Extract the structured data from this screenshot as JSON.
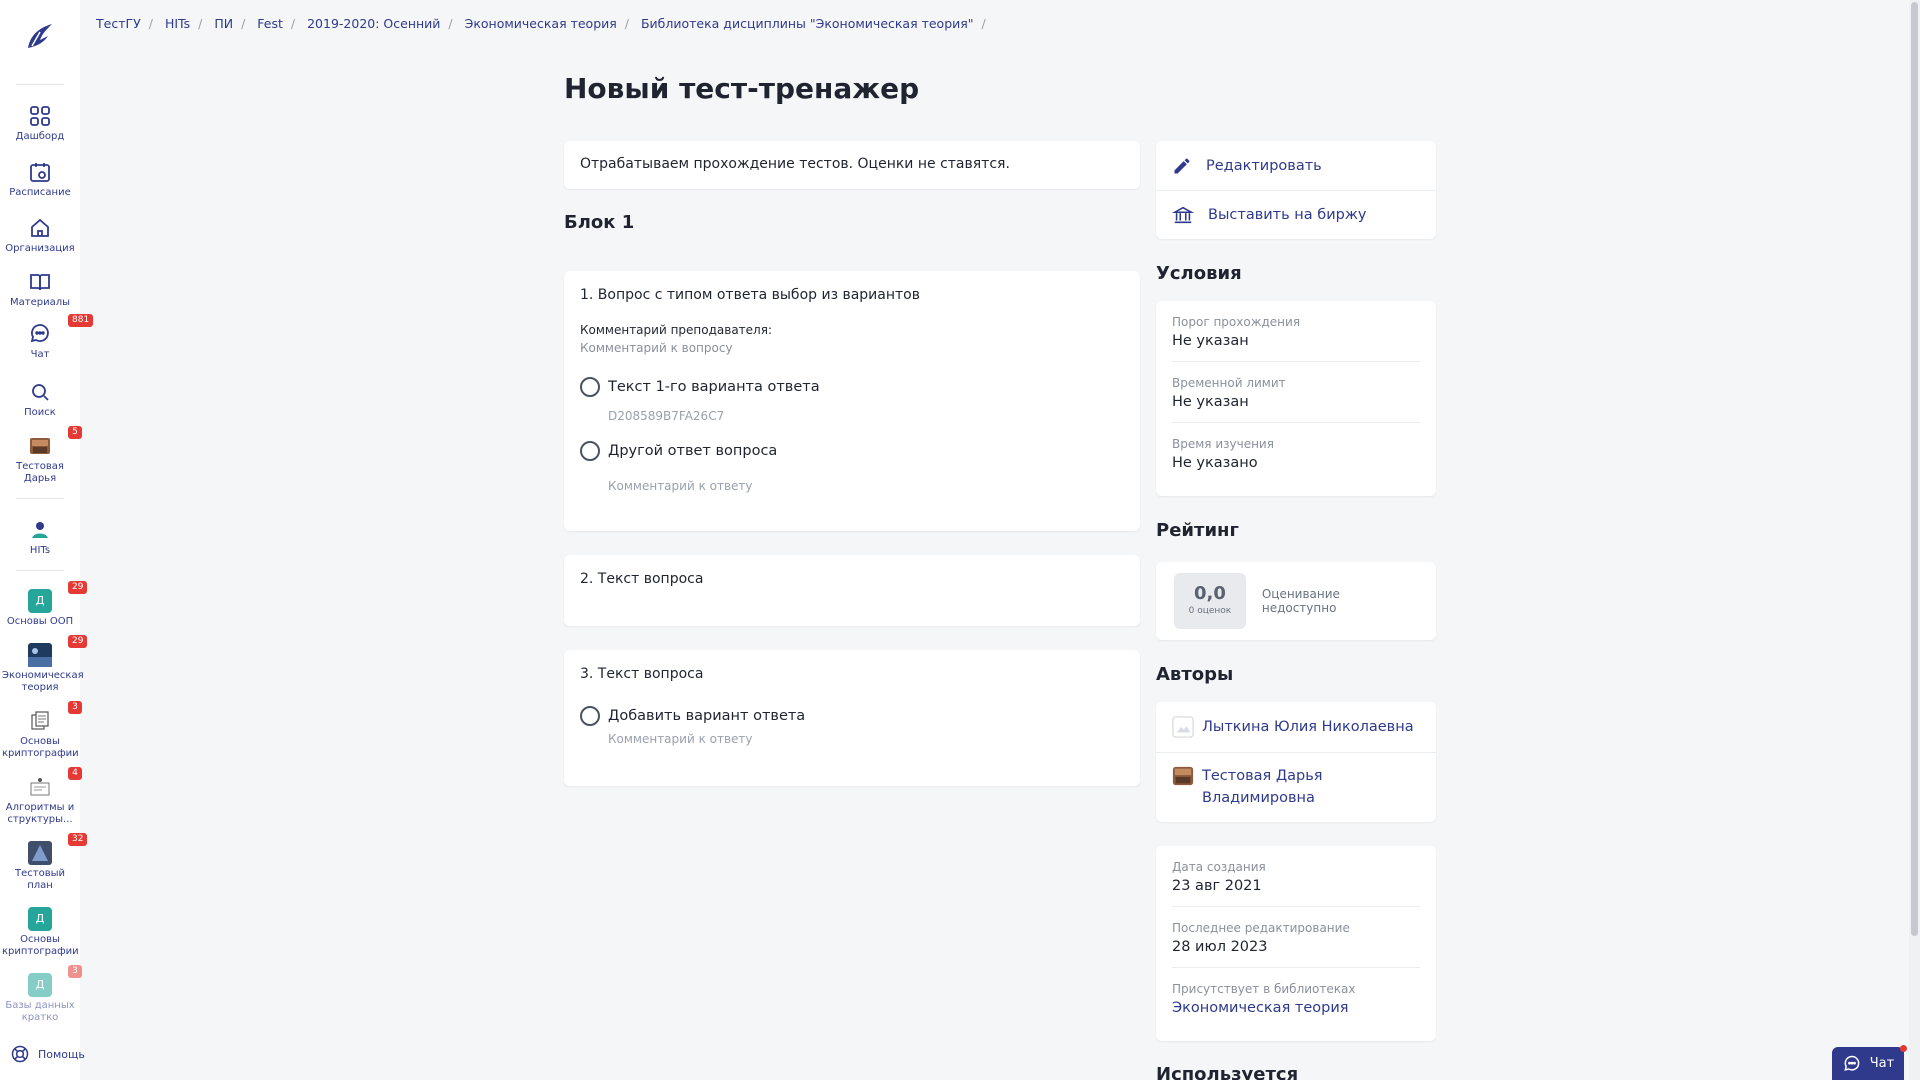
{
  "colors": {
    "accent": "#2f3a8c",
    "badge": "#e53935",
    "teal": "#26a69a"
  },
  "breadcrumbs": [
    "ТестГУ",
    "HITs",
    "ПИ",
    "Fest",
    "2019-2020: Осенний",
    "Экономическая теория",
    "Библиотека дисциплины \"Экономическая теория\""
  ],
  "sidebar": {
    "items": [
      {
        "label": "Дашборд",
        "icon": "grid-icon"
      },
      {
        "label": "Расписание",
        "icon": "calendar-icon"
      },
      {
        "label": "Организация",
        "icon": "home-icon"
      },
      {
        "label": "Материалы",
        "icon": "book-icon"
      },
      {
        "label": "Чат",
        "icon": "chat-icon",
        "badge": "881"
      },
      {
        "label": "Поиск",
        "icon": "search-icon"
      },
      {
        "label": "Тестовая Дарья",
        "icon": "avatar-icon",
        "badge": "5"
      },
      {
        "label": "HITs",
        "icon": "hits-logo-icon"
      },
      {
        "label": "Основы ООП",
        "icon": "course-icon",
        "badge": "29",
        "letter": "Д"
      },
      {
        "label": "Экономическая теория",
        "icon": "course-image-icon",
        "badge": "29"
      },
      {
        "label": "Основы криптографии",
        "icon": "course-image-icon",
        "badge": "3"
      },
      {
        "label": "Алгоритмы и структуры...",
        "icon": "course-image-icon",
        "badge": "4"
      },
      {
        "label": "Тестовый план",
        "icon": "course-image-icon",
        "badge": "32"
      },
      {
        "label": "Основы криптографии",
        "icon": "course-icon",
        "letter": "Д"
      },
      {
        "label": "Базы данных кратко",
        "icon": "course-icon",
        "badge": "3",
        "letter": "Д"
      }
    ],
    "help_label": "Помощь"
  },
  "page": {
    "title": "Новый тест-тренажер",
    "description": "Отрабатываем прохождение тестов. Оценки не ставятся.",
    "block_title": "Блок 1"
  },
  "questions": [
    {
      "title": "1. Вопрос с типом ответа выбор из вариантов",
      "comment_label": "Комментарий преподавателя:",
      "comment_value": "Комментарий к вопросу",
      "options": [
        {
          "text": "Текст 1-го варианта ответа",
          "sub": "D208589B7FA26C7"
        },
        {
          "text": "Другой ответ вопроса",
          "sub": "Комментарий к ответу"
        }
      ]
    },
    {
      "title": "2. Текст вопроса"
    },
    {
      "title": "3. Текст вопроса",
      "options": [
        {
          "text": "Добавить вариант ответа",
          "sub": "Комментарий к ответу"
        }
      ]
    }
  ],
  "actions": {
    "edit": "Редактировать",
    "exchange": "Выставить на биржу"
  },
  "conditions": {
    "title": "Условия",
    "rows": [
      {
        "k": "Порог прохождения",
        "v": "Не указан"
      },
      {
        "k": "Временной лимит",
        "v": "Не указан"
      },
      {
        "k": "Время изучения",
        "v": "Не указано"
      }
    ]
  },
  "rating": {
    "title": "Рейтинг",
    "score": "0,0",
    "count": "0 оценок",
    "note": "Оценивание недоступно"
  },
  "authors": {
    "title": "Авторы",
    "list": [
      "Лыткина Юлия Николаевна",
      "Тестовая Дарья Владимировна"
    ]
  },
  "meta": {
    "rows": [
      {
        "k": "Дата создания",
        "v": "23 авг 2021"
      },
      {
        "k": "Последнее редактирование",
        "v": "28 июл 2023"
      },
      {
        "k": "Присутствует в библиотеках",
        "v": "Экономическая теория"
      }
    ]
  },
  "used_title": "Используется",
  "chat_button": "Чат"
}
